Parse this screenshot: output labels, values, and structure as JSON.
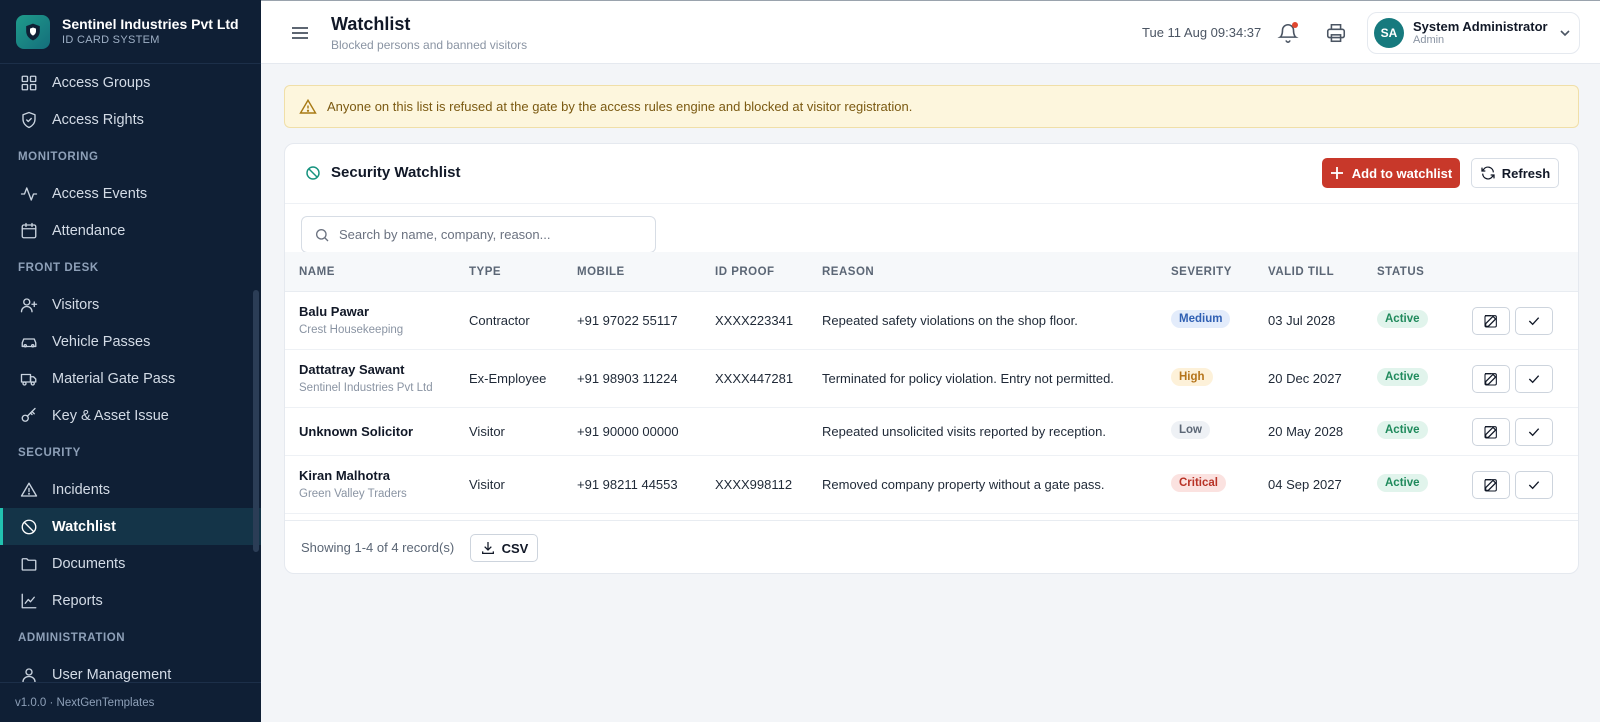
{
  "brand": {
    "name": "Sentinel Industries Pvt Ltd",
    "subtitle": "ID CARD SYSTEM"
  },
  "sidebar": {
    "items": [
      {
        "type": "item",
        "label": "Access Groups",
        "icon": "grid-icon"
      },
      {
        "type": "item",
        "label": "Access Rights",
        "icon": "shield-check-icon"
      },
      {
        "type": "section",
        "label": "MONITORING"
      },
      {
        "type": "item",
        "label": "Access Events",
        "icon": "activity-icon"
      },
      {
        "type": "item",
        "label": "Attendance",
        "icon": "calendar-icon"
      },
      {
        "type": "section",
        "label": "FRONT DESK"
      },
      {
        "type": "item",
        "label": "Visitors",
        "icon": "user-plus-icon"
      },
      {
        "type": "item",
        "label": "Vehicle Passes",
        "icon": "car-icon"
      },
      {
        "type": "item",
        "label": "Material Gate Pass",
        "icon": "truck-icon"
      },
      {
        "type": "item",
        "label": "Key & Asset Issue",
        "icon": "key-icon"
      },
      {
        "type": "section",
        "label": "SECURITY"
      },
      {
        "type": "item",
        "label": "Incidents",
        "icon": "alert-triangle-icon"
      },
      {
        "type": "item",
        "label": "Watchlist",
        "icon": "ban-icon",
        "active": true
      },
      {
        "type": "item",
        "label": "Documents",
        "icon": "folder-icon"
      },
      {
        "type": "item",
        "label": "Reports",
        "icon": "line-chart-icon"
      },
      {
        "type": "section",
        "label": "ADMINISTRATION"
      },
      {
        "type": "item",
        "label": "User Management",
        "icon": "user-icon"
      }
    ],
    "footer": "v1.0.0 · NextGenTemplates"
  },
  "header": {
    "title": "Watchlist",
    "subtitle": "Blocked persons and banned visitors",
    "datetime": "Tue 11 Aug 09:34:37",
    "user": {
      "initials": "SA",
      "name": "System Administrator",
      "role": "Admin"
    }
  },
  "alert": {
    "text": "Anyone on this list is refused at the gate by the access rules engine and blocked at visitor registration."
  },
  "card": {
    "title": "Security Watchlist",
    "add_label": "Add to watchlist",
    "refresh_label": "Refresh",
    "search_placeholder": "Search by name, company, reason...",
    "columns": {
      "name": "NAME",
      "type": "TYPE",
      "mobile": "MOBILE",
      "idproof": "ID PROOF",
      "reason": "REASON",
      "severity": "SEVERITY",
      "valid": "VALID TILL",
      "status": "STATUS"
    },
    "rows": [
      {
        "name": "Balu Pawar",
        "company": "Crest Housekeeping",
        "type": "Contractor",
        "mobile": "+91 97022 55117",
        "idproof": "XXXX223341",
        "reason": "Repeated safety violations on the shop floor.",
        "severity": "Medium",
        "valid": "03 Jul 2028",
        "status": "Active"
      },
      {
        "name": "Dattatray Sawant",
        "company": "Sentinel Industries Pvt Ltd",
        "type": "Ex-Employee",
        "mobile": "+91 98903 11224",
        "idproof": "XXXX447281",
        "reason": "Terminated for policy violation. Entry not permitted.",
        "severity": "High",
        "valid": "20 Dec 2027",
        "status": "Active"
      },
      {
        "name": "Unknown Solicitor",
        "company": "",
        "type": "Visitor",
        "mobile": "+91 90000 00000",
        "idproof": "",
        "reason": "Repeated unsolicited visits reported by reception.",
        "severity": "Low",
        "valid": "20 May 2028",
        "status": "Active"
      },
      {
        "name": "Kiran Malhotra",
        "company": "Green Valley Traders",
        "type": "Visitor",
        "mobile": "+91 98211 44553",
        "idproof": "XXXX998112",
        "reason": "Removed company property without a gate pass.",
        "severity": "Critical",
        "valid": "04 Sep 2027",
        "status": "Active"
      }
    ],
    "footer_count": "Showing 1-4 of 4 record(s)",
    "csv_label": "CSV"
  },
  "colors": {
    "sidebar_bg": "#0f1f35",
    "accent": "#22c2b0",
    "danger_button": "#c8382a",
    "severity": {
      "Medium": {
        "bg": "#e3ecfb",
        "fg": "#2f5fb3"
      },
      "High": {
        "bg": "#fdf1d9",
        "fg": "#b5741a"
      },
      "Low": {
        "bg": "#eef1f5",
        "fg": "#5b6675"
      },
      "Critical": {
        "bg": "#fbe2e0",
        "fg": "#b83226"
      }
    },
    "status_active": {
      "bg": "#e1f4ec",
      "fg": "#1f8a5c"
    }
  }
}
